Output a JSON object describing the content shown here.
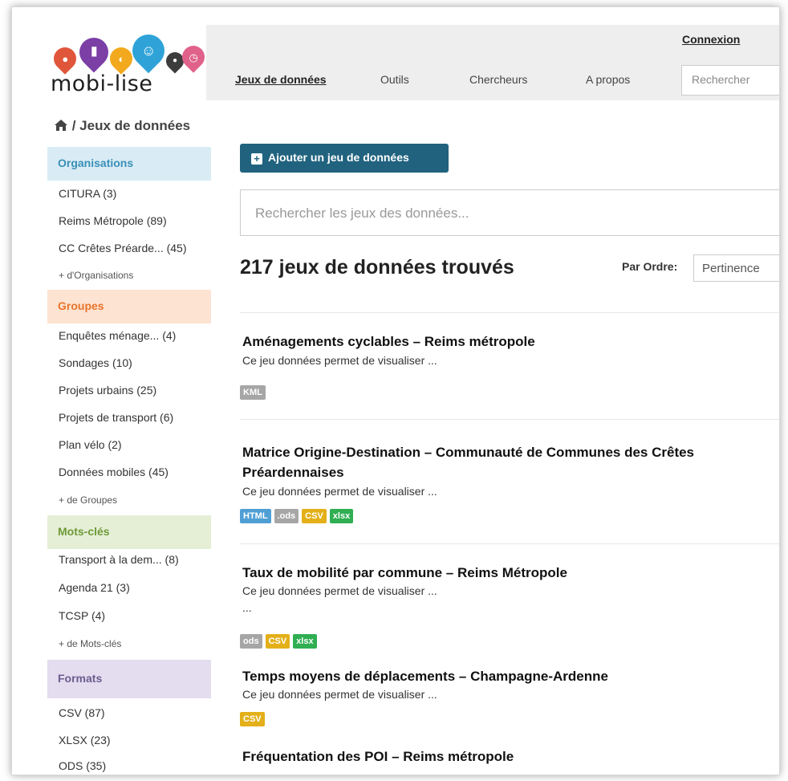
{
  "header": {
    "logo_text": "mobi-lise",
    "login_label": "Connexion",
    "nav": [
      "Jeux de données",
      "Outils",
      "Chercheurs",
      "A propos"
    ],
    "search_placeholder": "Rechercher"
  },
  "breadcrumb": {
    "text": "/ Jeux de données"
  },
  "sidebar": {
    "organisations": {
      "title": "Organisations",
      "items": [
        "CITURA (3)",
        "Reims Métropole (89)",
        "CC Crêtes Préarde... (45)"
      ],
      "more": "+ d'Organisations"
    },
    "groupes": {
      "title": "Groupes",
      "items": [
        "Enquêtes ménage... (4)",
        "Sondages (10)",
        "Projets urbains (25)",
        "Projets de transport (6)",
        "Plan vélo (2)",
        "Données mobiles (45)"
      ],
      "more": "+ de Groupes"
    },
    "motscles": {
      "title": "Mots-clés",
      "items": [
        "Transport à la dem... (8)",
        "Agenda 21 (3)",
        "TCSP (4)"
      ],
      "more": "+ de Mots-clés"
    },
    "formats": {
      "title": "Formats",
      "items": [
        "CSV (87)",
        "XLSX (23)",
        "ODS (35)"
      ]
    }
  },
  "main": {
    "add_button": "Ajouter un jeu de données",
    "search_placeholder": "Rechercher les jeux des données...",
    "count": "217 jeux de données trouvés",
    "sort_label": "Par Ordre:",
    "sort_value": "Pertinence",
    "datasets": [
      {
        "title": "Aménagements cyclables – Reims métropole",
        "desc": "Ce jeu données permet de visualiser ...",
        "badges": [
          "KML"
        ]
      },
      {
        "title": "Matrice Origine-Destination – Communauté de Communes des Crêtes Préardennaises",
        "desc": "Ce jeu données permet de visualiser ...",
        "badges": [
          "HTML",
          ".ods",
          "CSV",
          "xlsx"
        ]
      },
      {
        "title": "Taux de mobilité par commune – Reims Métropole",
        "desc": "Ce jeu données permet de visualiser ...",
        "extra": "...",
        "badges": [
          "ods",
          "CSV",
          "xlsx"
        ]
      },
      {
        "title": "Temps moyens de déplacements – Champagne-Ardenne",
        "desc": "Ce jeu données permet de visualiser ...",
        "badges": [
          "CSV"
        ]
      },
      {
        "title": "Fréquentation des POI – Reims métropole"
      }
    ]
  },
  "colors": {
    "organisations_bg": "#d9ecf5",
    "organisations_fg": "#3a8fb7",
    "groupes_bg": "#fde3d2",
    "groupes_fg": "#e8742a",
    "motscles_bg": "#e4efd6",
    "motscles_fg": "#6f9a37",
    "formats_bg": "#e4dcef",
    "formats_fg": "#6a5d8f",
    "badge_html": "#4f9fd5",
    "badge_grey": "#a6a6a6",
    "badge_csv": "#e3b019",
    "badge_xlsx": "#2fae52",
    "button": "#21637f"
  }
}
